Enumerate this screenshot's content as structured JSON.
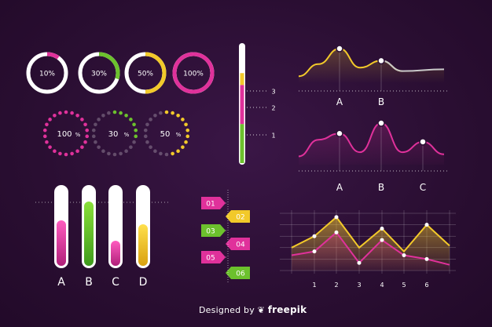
{
  "colors": {
    "pink": "#e0319b",
    "green": "#6cc12d",
    "yellow": "#f2c92a",
    "grey": "#c9c9c9",
    "white": "#ffffff",
    "bg": "#2b0f33"
  },
  "donuts": [
    {
      "label": "10%",
      "value": 10,
      "color": "#e0319b"
    },
    {
      "label": "30%",
      "value": 30,
      "color": "#6cc12d"
    },
    {
      "label": "50%",
      "value": 50,
      "color": "#f2c92a"
    },
    {
      "label": "100%",
      "value": 100,
      "color": "#e0319b"
    }
  ],
  "dot_rings": [
    {
      "label": "100",
      "unit": "%",
      "value": 100,
      "color": "#e0319b"
    },
    {
      "label": "30",
      "unit": "%",
      "value": 30,
      "color": "#6cc12d"
    },
    {
      "label": "50",
      "unit": "%",
      "value": 50,
      "color": "#f2c92a"
    }
  ],
  "vertical_gauge": {
    "levels": [
      "3",
      "2",
      "1"
    ],
    "segments": [
      {
        "color": "#6cc12d",
        "fraction": 0.33
      },
      {
        "color": "#e0319b",
        "fraction": 0.33
      },
      {
        "color": "#f2c92a",
        "fraction": 0.1
      }
    ]
  },
  "thermo_bars": [
    {
      "label": "A",
      "value": 0.58,
      "color": "#e0319b"
    },
    {
      "label": "B",
      "value": 0.82,
      "color": "#6cc12d"
    },
    {
      "label": "C",
      "value": 0.32,
      "color": "#e0319b"
    },
    {
      "label": "D",
      "value": 0.53,
      "color": "#f2c92a"
    }
  ],
  "steps": [
    {
      "label": "01",
      "color": "#e0319b",
      "side": "left"
    },
    {
      "label": "02",
      "color": "#f2c92a",
      "side": "right"
    },
    {
      "label": "03",
      "color": "#6cc12d",
      "side": "left"
    },
    {
      "label": "04",
      "color": "#e0319b",
      "side": "right"
    },
    {
      "label": "05",
      "color": "#e0319b",
      "side": "left"
    },
    {
      "label": "06",
      "color": "#6cc12d",
      "side": "right"
    }
  ],
  "chart_data": [
    {
      "type": "line",
      "labels": [
        "A",
        "B"
      ],
      "series": [
        {
          "values": [
            0.2,
            0.55,
            1.0,
            0.45,
            0.65,
            0.35,
            0.4
          ]
        }
      ],
      "markers": [
        {
          "label": "A",
          "value": 1.0
        },
        {
          "label": "B",
          "value": 0.65
        }
      ]
    },
    {
      "type": "line",
      "labels": [
        "A",
        "B",
        "C"
      ],
      "series": [
        {
          "values": [
            0.2,
            0.6,
            0.75,
            0.3,
            1.0,
            0.3,
            0.55,
            0.25
          ]
        }
      ],
      "markers": [
        {
          "label": "A",
          "value": 0.75
        },
        {
          "label": "B",
          "value": 1.0
        },
        {
          "label": "C",
          "value": 0.55
        }
      ]
    },
    {
      "type": "area",
      "categories": [
        "1",
        "2",
        "3",
        "4",
        "5",
        "6"
      ],
      "series": [
        {
          "color": "#f2c92a",
          "values": [
            6,
            11,
            3,
            8,
            2,
            9
          ]
        },
        {
          "color": "#e0319b",
          "values": [
            2,
            7,
            -1,
            5,
            1,
            0
          ]
        }
      ]
    }
  ],
  "credit": {
    "prefix": "Designed by",
    "brand": "freepik"
  }
}
